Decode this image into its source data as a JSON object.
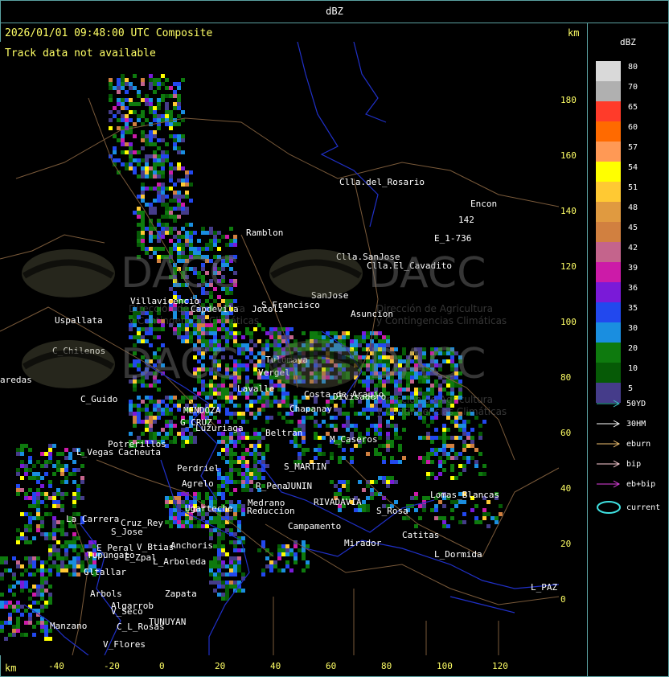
{
  "header": {
    "title": "dBZ"
  },
  "status_line": "2026/01/01 09:48:00 UTC Composite",
  "track_message": "Track data not available",
  "units": {
    "km_top": "km",
    "km_bottom": "km"
  },
  "sidebar": {
    "title": "dBZ",
    "colorscale": [
      {
        "label": "80",
        "color": "#d9d9d9"
      },
      {
        "label": "70",
        "color": "#b0b0b0"
      },
      {
        "label": "65",
        "color": "#ff3b2a"
      },
      {
        "label": "60",
        "color": "#ff6a00"
      },
      {
        "label": "57",
        "color": "#ff9955"
      },
      {
        "label": "54",
        "color": "#ffff00"
      },
      {
        "label": "51",
        "color": "#ffc933"
      },
      {
        "label": "48",
        "color": "#e09a40"
      },
      {
        "label": "45",
        "color": "#d18040"
      },
      {
        "label": "42",
        "color": "#c4648c"
      },
      {
        "label": "39",
        "color": "#cc1ba8"
      },
      {
        "label": "36",
        "color": "#7a1ad8"
      },
      {
        "label": "35",
        "color": "#2248ee"
      },
      {
        "label": "30",
        "color": "#1a8ee0"
      },
      {
        "label": "20",
        "color": "#0e7a0e"
      },
      {
        "label": "10",
        "color": "#065a06"
      },
      {
        "label": "5",
        "color": "#453c8a"
      }
    ],
    "legend": [
      {
        "label": "50YD",
        "color": "#3fc4c4",
        "icon": "arrow-icon"
      },
      {
        "label": "30HM",
        "color": "#ffffff",
        "icon": "arrow-icon"
      },
      {
        "label": "eburn",
        "color": "#f0c070",
        "icon": "arrow-icon"
      },
      {
        "label": "bip",
        "color": "#ffd0d8",
        "icon": "arrow-icon"
      },
      {
        "label": "eb+bip",
        "color": "#e040e0",
        "icon": "arrow-icon"
      },
      {
        "label": "current",
        "color": "#3fe0e0",
        "icon": "ellipse-icon"
      }
    ]
  },
  "axes": {
    "x_ticks": [
      "-40",
      "-20",
      "0",
      "20",
      "40",
      "60",
      "80",
      "100",
      "120"
    ],
    "y_ticks": [
      "180",
      "160",
      "140",
      "120",
      "100",
      "80",
      "60",
      "40",
      "20",
      "0"
    ]
  },
  "watermark": {
    "logo_text": "DACC",
    "line1": "Dirección de Agricultura",
    "line2": "y Contingencias Climáticas"
  },
  "places": [
    "Clla.del_Rosario",
    "Encon",
    "142",
    "E_1-736",
    "Ramblon",
    "Clla.SanJose",
    "Clla.El_Cavadito",
    "Villavicencio",
    "Capdevila",
    "S_Francisco",
    "SanJose",
    "Asuncion",
    "Uspallata",
    "C_Chilenos",
    "aredas",
    "C_Guido",
    "MENDOZA",
    "G_CRUZ",
    "Luzuriaga",
    "Potrerillos",
    "L_Vegas",
    "Cacheuta",
    "Perdriel",
    "Agrelo",
    "Tulumaya",
    "Vergel",
    "Jocoli",
    "Lavalle",
    "Divisadero",
    "Costa_de_Araujo",
    "Chapanay",
    "Beltran",
    "M_Caseros",
    "S_MARTIN",
    "JUNIN",
    "R_Pena",
    "RIVADAVIA",
    "Medrano",
    "Reduccion",
    "Ugarteche",
    "Anchoris",
    "Tupungato",
    "Cruz_Rey",
    "S_Jose",
    "E_Peral",
    "V_Btias",
    "E_Zpal",
    "Gltallar",
    "Arbols",
    "L_Arboleda",
    "Zapata",
    "La_Carrera",
    "Algarrob",
    "V_Seco",
    "TUNUYAN",
    "Manzano",
    "C_L_Rosas",
    "V_Flores",
    "Lomas_Blancas",
    "Catitas",
    "Mirador",
    "S_Rosa",
    "L_Dormida",
    "L_PAZ",
    "Campamento"
  ]
}
